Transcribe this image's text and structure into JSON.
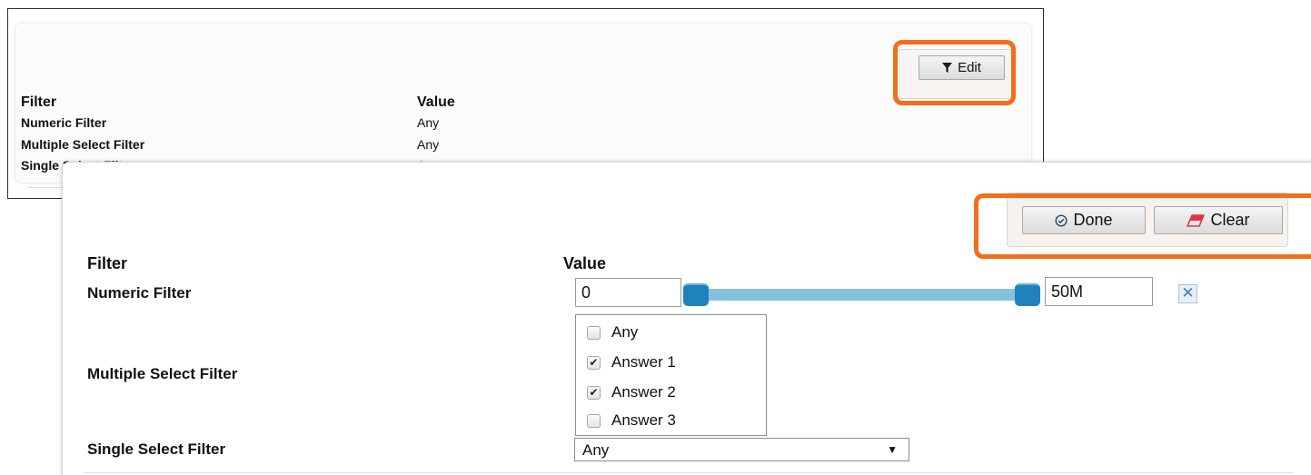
{
  "view_panel": {
    "edit_label": "Edit",
    "header_filter": "Filter",
    "header_value": "Value",
    "rows": [
      {
        "label": "Numeric Filter",
        "value": "Any"
      },
      {
        "label": "Multiple Select Filter",
        "value": "Any"
      },
      {
        "label": "Single Select Filter",
        "value": "Any"
      }
    ]
  },
  "edit_panel": {
    "done_label": "Done",
    "clear_label": "Clear",
    "header_filter": "Filter",
    "header_value": "Value",
    "numeric": {
      "label": "Numeric Filter",
      "min": "0",
      "max": "50M",
      "remove_symbol": "✕"
    },
    "multi": {
      "label": "Multiple Select Filter",
      "options": [
        {
          "label": "Any",
          "checked": false
        },
        {
          "label": "Answer 1",
          "checked": true
        },
        {
          "label": "Answer 2",
          "checked": true
        },
        {
          "label": "Answer 3",
          "checked": false
        }
      ]
    },
    "single": {
      "label": "Single Select Filter",
      "selected": "Any"
    }
  },
  "icons": {
    "edit": "filter-icon",
    "done": "check-circle-icon",
    "clear": "eraser-icon",
    "select_arrow": "caret-down-icon",
    "remove": "close-icon"
  },
  "colors": {
    "highlight": "#f36d1b",
    "slider_track": "#86c2de",
    "slider_handle": "#1f82bd",
    "clear_icon": "#e0344a"
  }
}
